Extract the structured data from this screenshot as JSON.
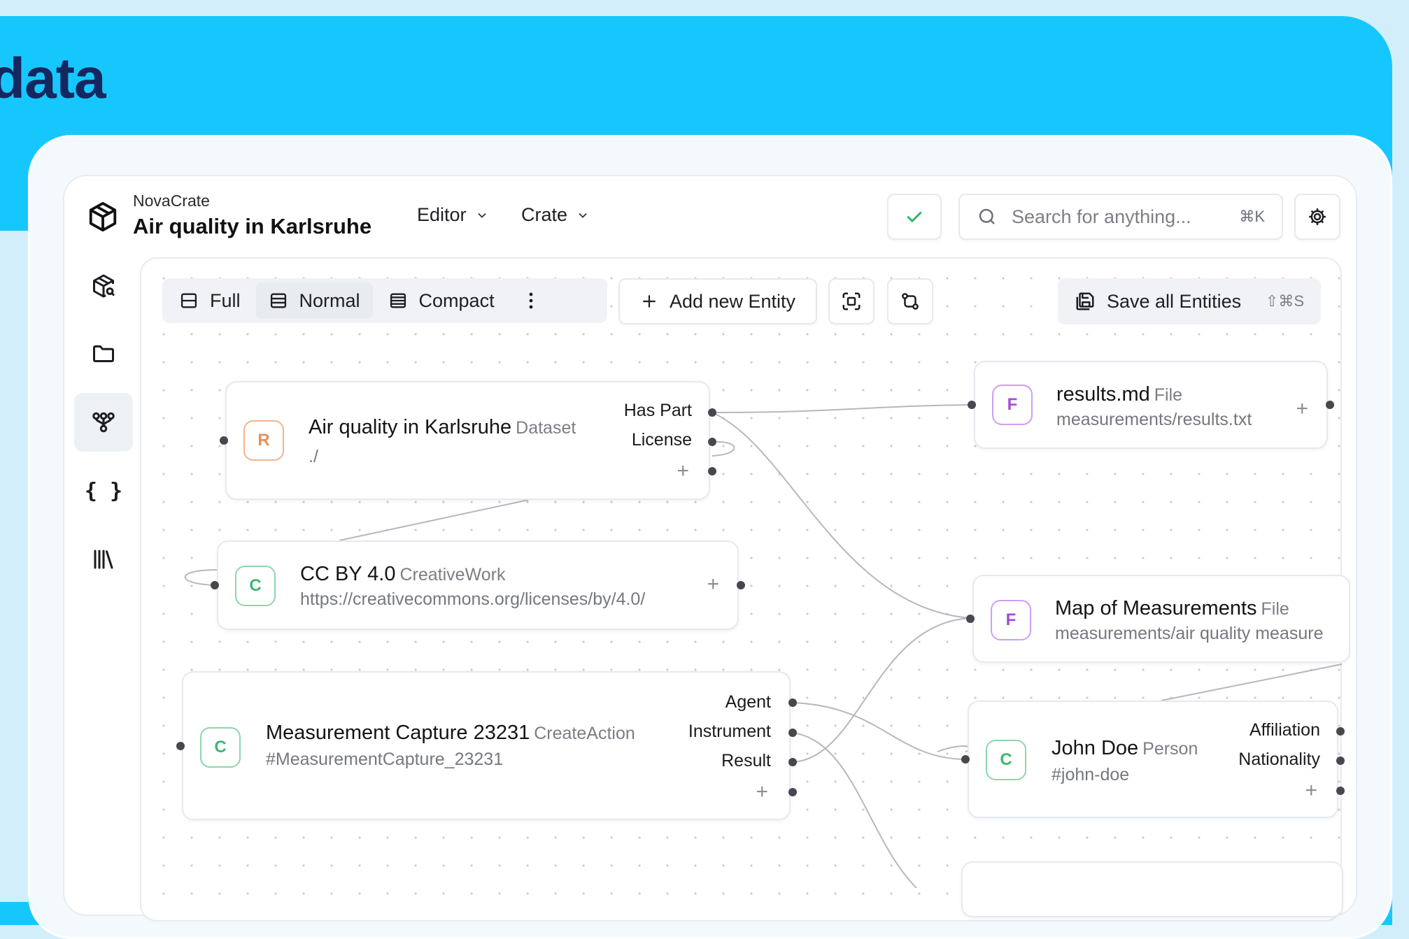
{
  "banner": {
    "title": "data"
  },
  "header": {
    "app_name": "NovaCrate",
    "crate_title": "Air quality in Karlsruhe",
    "menus": [
      "Editor",
      "Crate"
    ],
    "search_placeholder": "Search for anything...",
    "search_shortcut": "⌘K"
  },
  "sidebar": {
    "items": [
      {
        "icon": "package-search-icon"
      },
      {
        "icon": "folder-icon"
      },
      {
        "icon": "graph-icon",
        "active": true
      },
      {
        "icon": "braces-icon",
        "label": "{ }"
      },
      {
        "icon": "library-icon"
      }
    ]
  },
  "toolbar": {
    "views": [
      "Full",
      "Normal",
      "Compact"
    ],
    "add_entity": "Add new Entity",
    "save_all": "Save all Entities",
    "save_shortcut": "⇧⌘S"
  },
  "colors": {
    "banner": "#16c7fd",
    "dataset": "#e8915c",
    "creative": "#3fb772",
    "file": "#a54bd6",
    "check": "#2fb36a"
  },
  "entities": [
    {
      "badge": "R",
      "title": "Air quality in Karlsruhe",
      "type": "Dataset",
      "id": "./",
      "props": [
        "Has Part",
        "License"
      ]
    },
    {
      "badge": "C",
      "title": "CC BY 4.0",
      "type": "CreativeWork",
      "id": "https://creativecommons.org/licenses/by/4.0/",
      "props": []
    },
    {
      "badge": "C",
      "title": "Measurement Capture 23231",
      "type": "CreateAction",
      "id": "#MeasurementCapture_23231",
      "props": [
        "Agent",
        "Instrument",
        "Result"
      ]
    },
    {
      "badge": "F",
      "title": "results.md",
      "type": "File",
      "id": "measurements/results.txt",
      "props": []
    },
    {
      "badge": "F",
      "title": "Map of Measurements",
      "type": "File",
      "id": "measurements/air quality measure",
      "props": []
    },
    {
      "badge": "C",
      "title": "John Doe",
      "type": "Person",
      "id": "#john-doe",
      "props": [
        "Affiliation",
        "Nationality"
      ]
    }
  ]
}
